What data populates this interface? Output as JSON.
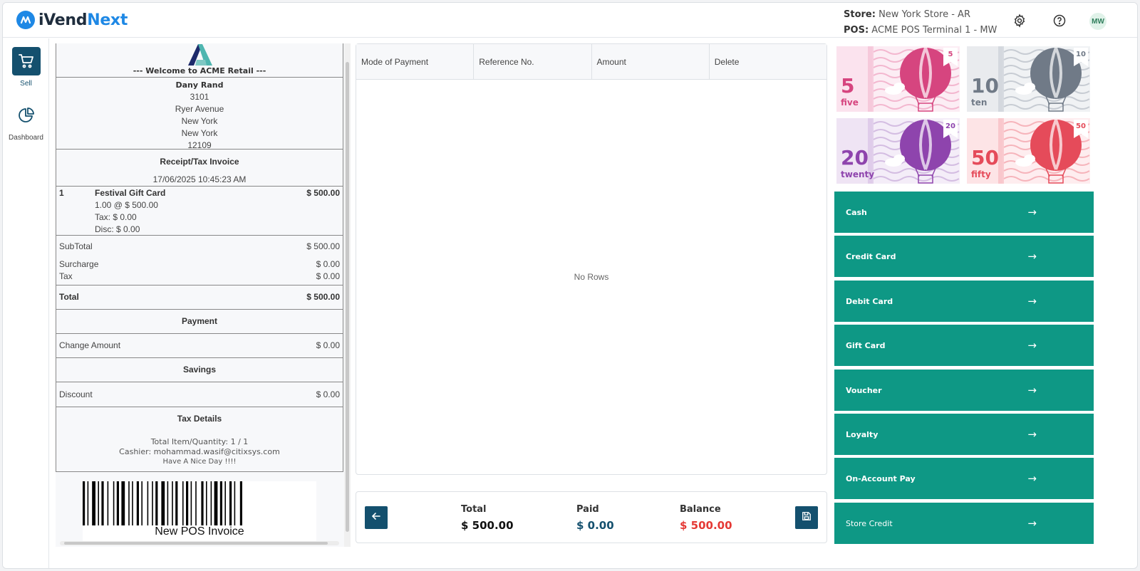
{
  "header": {
    "brand_a": "iVend",
    "brand_b": "Next",
    "store_label": "Store:",
    "store_value": "New York Store - AR",
    "pos_label": "POS:",
    "pos_value": "ACME POS Terminal 1 - MW",
    "avatar": "MW",
    "icons": [
      "settings-gear-icon",
      "help-icon"
    ]
  },
  "nav": {
    "items": [
      {
        "label": "Sell",
        "icon": "cart-icon",
        "active": true
      },
      {
        "label": "Dashboard",
        "icon": "pie-chart-icon",
        "active": false
      }
    ]
  },
  "receipt": {
    "welcome": "--- Welcome to ACME Retail ---",
    "customer": {
      "name": "Dany Rand",
      "lines": [
        "3101",
        "Ryer Avenue",
        "New York",
        "New York",
        "12109"
      ]
    },
    "invoice_title": "Receipt/Tax Invoice",
    "datetime": "17/06/2025 10:45:23 AM",
    "items": [
      {
        "qty": "1",
        "name": "Festival Gift Card",
        "amount": "$ 500.00",
        "detail": "1.00 @ $ 500.00",
        "tax": "Tax: $ 0.00",
        "disc": "Disc: $ 0.00"
      }
    ],
    "subtotal_label": "SubTotal",
    "subtotal": "$ 500.00",
    "surcharge_label": "Surcharge",
    "surcharge": "$ 0.00",
    "tax_label": "Tax",
    "tax": "$ 0.00",
    "total_label": "Total",
    "total": "$ 500.00",
    "payment_title": "Payment",
    "change_label": "Change Amount",
    "change": "$ 0.00",
    "savings_title": "Savings",
    "discount_label": "Discount",
    "discount": "$ 0.00",
    "tax_details_title": "Tax Details",
    "footer": {
      "qty_line": "Total Item/Quantity: 1 / 1",
      "cashier_line": "Cashier: mohammad.wasif@citixsys.com",
      "goodbye": "Have A Nice Day !!!!"
    },
    "barcode_label": "New POS Invoice"
  },
  "grid": {
    "columns": [
      "Mode of Payment",
      "Reference No.",
      "Amount",
      "Delete"
    ],
    "empty_text": "No Rows"
  },
  "totals": {
    "total_label": "Total",
    "total": "$ 500.00",
    "paid_label": "Paid",
    "paid": "$ 0.00",
    "balance_label": "Balance",
    "balance": "$ 500.00",
    "colors": {
      "total": "#111111",
      "paid": "#14506e",
      "balance": "#e53935"
    },
    "icons": [
      "back-arrow-icon",
      "save-icon"
    ]
  },
  "notes": [
    {
      "num": "5",
      "word": "five",
      "color": "#d6457f",
      "bg": "#fbe3ee",
      "stripe": "#f3b7cf"
    },
    {
      "num": "10",
      "word": "ten",
      "color": "#707a87",
      "bg": "#e9ebee",
      "stripe": "#c7ccd3"
    },
    {
      "num": "20",
      "word": "twenty",
      "color": "#8e44ad",
      "bg": "#efe4f4",
      "stripe": "#d4bde2"
    },
    {
      "num": "50",
      "word": "fifty",
      "color": "#e54b5a",
      "bg": "#fde4e6",
      "stripe": "#f6b4bb"
    }
  ],
  "tenders": [
    "Cash",
    "Credit Card",
    "Debit Card",
    "Gift Card",
    "Voucher",
    "Loyalty",
    "On-Account Pay",
    "Store Credit"
  ],
  "tender_color": "#0e9885"
}
